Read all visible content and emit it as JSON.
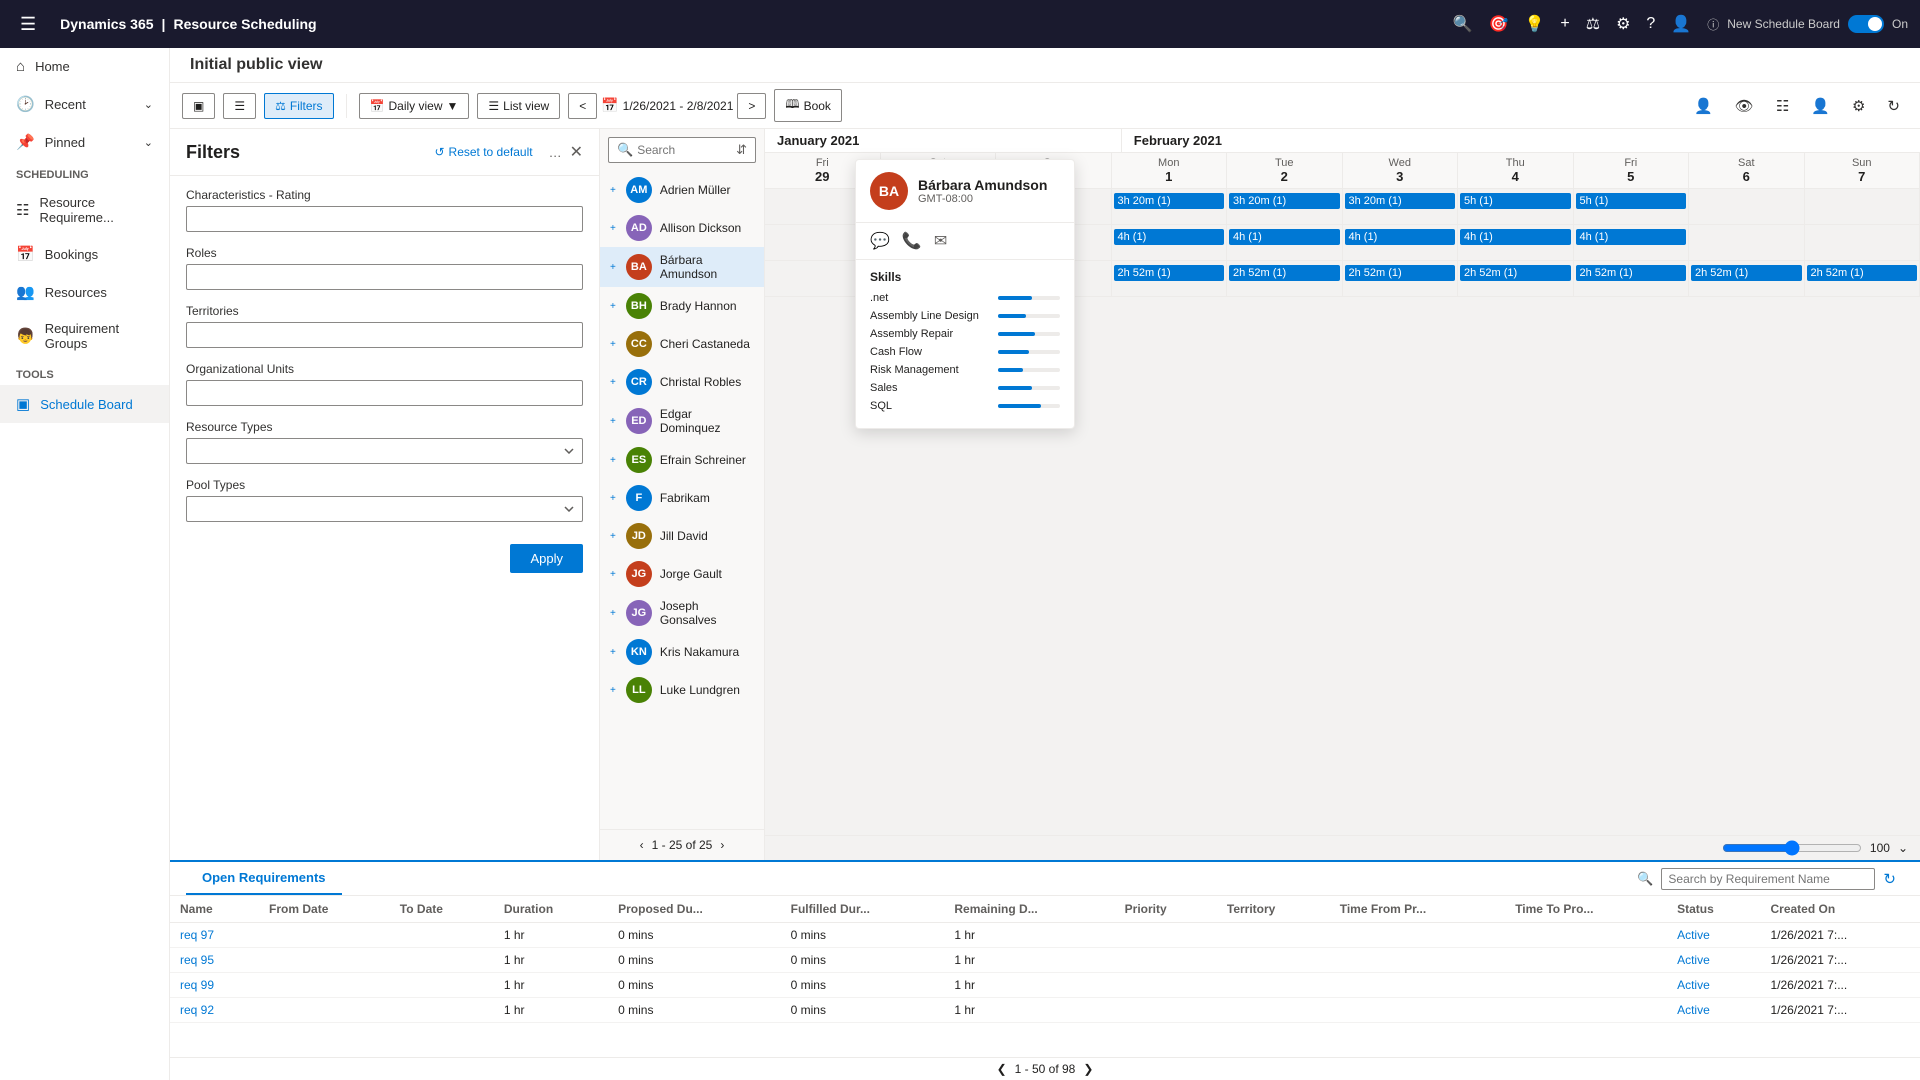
{
  "app": {
    "brand": "Dynamics 365",
    "divider": "|",
    "app_name": "Resource Scheduling"
  },
  "top_nav": {
    "new_schedule_board_label": "New Schedule Board",
    "toggle_state": "On"
  },
  "sidebar": {
    "home": "Home",
    "recent": "Recent",
    "pinned": "Pinned",
    "scheduling_section": "Scheduling",
    "resource_requirements": "Resource Requireme...",
    "bookings": "Bookings",
    "resources": "Resources",
    "requirement_groups": "Requirement Groups",
    "tools_section": "Tools",
    "schedule_board": "Schedule Board"
  },
  "breadcrumb": {
    "title": "Initial public view"
  },
  "toolbar": {
    "filters_label": "Filters",
    "daily_view_label": "Daily view",
    "list_view_label": "List view",
    "date_range": "1/26/2021 - 2/8/2021",
    "book_label": "Book"
  },
  "filters_panel": {
    "title": "Filters",
    "reset_label": "Reset to default",
    "characteristics_rating_label": "Characteristics - Rating",
    "roles_label": "Roles",
    "territories_label": "Territories",
    "org_units_label": "Organizational Units",
    "resource_types_label": "Resource Types",
    "pool_types_label": "Pool Types",
    "apply_label": "Apply"
  },
  "search_panel": {
    "placeholder": "Search",
    "pagination": "1 - 25 of 25"
  },
  "resources": [
    {
      "name": "Adrien Müller",
      "initials": "AM",
      "color": "#0078d4"
    },
    {
      "name": "Allison Dickson",
      "initials": "AD",
      "color": "#8764b8"
    },
    {
      "name": "Bárbara Amundson",
      "initials": "BA",
      "color": "#c43e1c",
      "selected": true
    },
    {
      "name": "Brady Hannon",
      "initials": "BH",
      "color": "#498205"
    },
    {
      "name": "Cheri Castaneda",
      "initials": "CC",
      "color": "#986f0b"
    },
    {
      "name": "Christal Robles",
      "initials": "CR",
      "color": "#0078d4"
    },
    {
      "name": "Edgar Dominquez",
      "initials": "ED",
      "color": "#8764b8"
    },
    {
      "name": "Efrain Schreiner",
      "initials": "ES",
      "color": "#498205"
    },
    {
      "name": "Fabrikam",
      "initials": "F",
      "color": "#0078d4"
    },
    {
      "name": "Jill David",
      "initials": "JD",
      "color": "#986f0b"
    },
    {
      "name": "Jorge Gault",
      "initials": "JG",
      "color": "#c43e1c"
    },
    {
      "name": "Joseph Gonsalves",
      "initials": "JG",
      "color": "#8764b8"
    },
    {
      "name": "Kris Nakamura",
      "initials": "KN",
      "color": "#0078d4"
    },
    {
      "name": "Luke Lundgren",
      "initials": "LL",
      "color": "#498205"
    }
  ],
  "popup": {
    "name": "Bárbara Amundson",
    "initials": "BA",
    "timezone": "GMT-08:00",
    "skills_title": "Skills",
    "skills": [
      {
        "name": ".net",
        "pct": 55
      },
      {
        "name": "Assembly Line Design",
        "pct": 45
      },
      {
        "name": "Assembly Repair",
        "pct": 60
      },
      {
        "name": "Cash Flow",
        "pct": 50
      },
      {
        "name": "Risk Management",
        "pct": 40
      },
      {
        "name": "Sales",
        "pct": 55
      },
      {
        "name": "SQL",
        "pct": 70
      }
    ]
  },
  "schedule": {
    "months": [
      {
        "label": "January 2021",
        "days": [
          "Fri 29",
          "Sat 30",
          "Sun 31"
        ]
      },
      {
        "label": "February 2021",
        "days": [
          "Mon 1",
          "Tue 2",
          "Wed 3",
          "Thu 4",
          "Fri 5",
          "Sat 6",
          "Sun 7"
        ]
      }
    ],
    "rows": [
      {
        "cells": [
          "",
          "",
          "",
          "3h 20m (1)",
          "3h 20m (1)",
          "3h 20m (1)",
          "5h (1)",
          "5h (1)",
          "",
          ""
        ]
      },
      {
        "cells": [
          "",
          "",
          "",
          "4h (1)",
          "4h (1)",
          "4h (1)",
          "4h (1)",
          "4h (1)",
          "",
          ""
        ]
      },
      {
        "cells": [
          "",
          "",
          "",
          "2h 52m (1)",
          "2h 52m (1)",
          "2h 52m (1)",
          "2h 52m (1)",
          "2h 52m (1)",
          "2h 52m (1)",
          "2h 52m (1)"
        ]
      }
    ]
  },
  "zoom": {
    "value": "100"
  },
  "bottom_panel": {
    "tab_label": "Open Requirements",
    "search_placeholder": "Search by Requirement Name",
    "columns": [
      "Name",
      "From Date",
      "To Date",
      "Duration",
      "Proposed Du...",
      "Fulfilled Dur...",
      "Remaining D...",
      "Priority",
      "Territory",
      "Time From Pr...",
      "Time To Pro...",
      "Status",
      "Created On"
    ],
    "rows": [
      {
        "name": "req 97",
        "from_date": "",
        "to_date": "",
        "duration": "1 hr",
        "proposed": "0 mins",
        "fulfilled": "0 mins",
        "remaining": "1 hr",
        "priority": "",
        "territory": "",
        "time_from": "",
        "time_to": "",
        "status": "Active",
        "created": "1/26/2021 7:..."
      },
      {
        "name": "req 95",
        "from_date": "",
        "to_date": "",
        "duration": "1 hr",
        "proposed": "0 mins",
        "fulfilled": "0 mins",
        "remaining": "1 hr",
        "priority": "",
        "territory": "",
        "time_from": "",
        "time_to": "",
        "status": "Active",
        "created": "1/26/2021 7:..."
      },
      {
        "name": "req 99",
        "from_date": "",
        "to_date": "",
        "duration": "1 hr",
        "proposed": "0 mins",
        "fulfilled": "0 mins",
        "remaining": "1 hr",
        "priority": "",
        "territory": "",
        "time_from": "",
        "time_to": "",
        "status": "Active",
        "created": "1/26/2021 7:..."
      },
      {
        "name": "req 92",
        "from_date": "",
        "to_date": "",
        "duration": "1 hr",
        "proposed": "0 mins",
        "fulfilled": "0 mins",
        "remaining": "1 hr",
        "priority": "",
        "territory": "",
        "time_from": "",
        "time_to": "",
        "status": "Active",
        "created": "1/26/2021 7:..."
      }
    ],
    "pagination": "1 - 50 of 98"
  }
}
